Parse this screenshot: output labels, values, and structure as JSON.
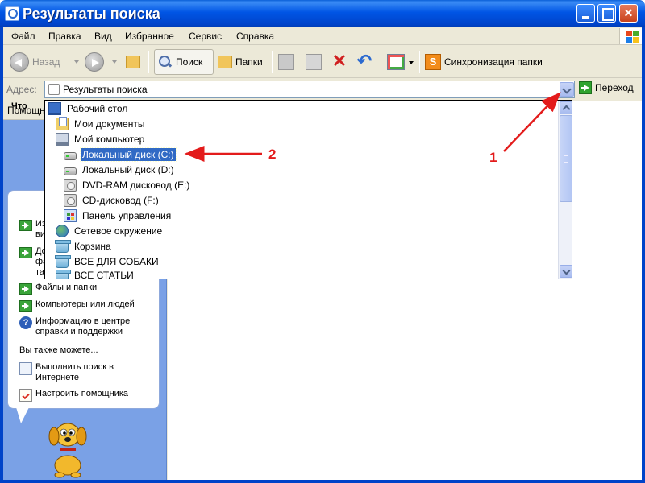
{
  "window": {
    "title": "Результаты поиска",
    "accent_color": "#0055e5"
  },
  "menu": [
    "Файл",
    "Правка",
    "Вид",
    "Избранное",
    "Сервис",
    "Справка"
  ],
  "toolbar": {
    "back_label": "Назад",
    "search_label": "Поиск",
    "folders_label": "Папки",
    "sync_label": "Синхронизация папки"
  },
  "address": {
    "label": "Адрес:",
    "value": "Результаты поиска",
    "go_label": "Переход"
  },
  "assistant": {
    "header": "Помощник",
    "panel_title": "Что в",
    "items": [
      {
        "lines": [
          "Из",
          "ви"
        ],
        "icon": "green-arrow-icon"
      },
      {
        "lines": [
          "До",
          "фа",
          "та"
        ],
        "icon": "green-arrow-icon"
      },
      {
        "lines": [
          "Файлы и папки"
        ],
        "icon": "green-arrow-icon"
      },
      {
        "lines": [
          "Компьютеры или людей"
        ],
        "icon": "green-arrow-icon"
      },
      {
        "lines": [
          "Информацию в центре",
          "справки и поддержки"
        ],
        "icon": "help-icon"
      }
    ],
    "also_label": "Вы также можете...",
    "also_items": [
      {
        "lines": [
          "Выполнить поиск в",
          "Интернете"
        ],
        "icon": "web-search-icon"
      },
      {
        "lines": [
          "Настроить помощника"
        ],
        "icon": "notepad-icon"
      }
    ]
  },
  "dropdown": {
    "items": [
      {
        "label": "Рабочий стол",
        "icon": "desktop-icon",
        "indent": 0
      },
      {
        "label": "Мои документы",
        "icon": "documents-icon",
        "indent": 1
      },
      {
        "label": "Мой компьютер",
        "icon": "computer-icon",
        "indent": 1
      },
      {
        "label": "Локальный диск (C:)",
        "icon": "disk-icon",
        "indent": 2,
        "selected": true
      },
      {
        "label": "Локальный диск (D:)",
        "icon": "disk-icon",
        "indent": 2
      },
      {
        "label": "DVD-RAM дисковод (E:)",
        "icon": "cd-drive-icon",
        "indent": 2
      },
      {
        "label": "CD-дисковод (F:)",
        "icon": "cd-drive-icon",
        "indent": 2
      },
      {
        "label": "Панель управления",
        "icon": "control-panel-icon",
        "indent": 2
      },
      {
        "label": "Сетевое окружение",
        "icon": "network-icon",
        "indent": 1
      },
      {
        "label": "Корзина",
        "icon": "recycle-bin-icon",
        "indent": 1
      },
      {
        "label": "ВСЕ ДЛЯ СОБАКИ",
        "icon": "folder-icon",
        "indent": 1
      },
      {
        "label": "ВСЕ СТАТЬИ",
        "icon": "folder-icon",
        "indent": 1
      }
    ]
  },
  "annotations": {
    "label_1": "1",
    "label_2": "2",
    "color": "#e31b1b"
  }
}
